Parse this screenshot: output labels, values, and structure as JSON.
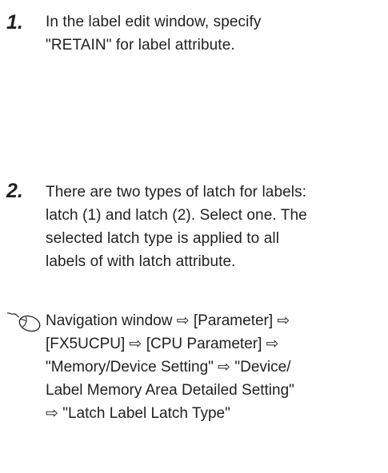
{
  "steps": [
    {
      "number": "1.",
      "lines": [
        "In the label edit window, specify",
        "\"RETAIN\" for label attribute."
      ]
    },
    {
      "number": "2.",
      "lines": [
        "There are two types of latch for labels:",
        "latch (1) and latch (2). Select one. The",
        "selected latch type is applied to all",
        "labels of with latch attribute."
      ]
    }
  ],
  "navigation": {
    "icon": "mouse-icon",
    "lines": [
      "Navigation window ⇨ [Parameter] ⇨",
      "[FX5UCPU] ⇨ [CPU Parameter] ⇨",
      "\"Memory/Device Setting\" ⇨ \"Device/",
      "Label Memory Area Detailed Setting\"",
      "⇨ \"Latch Label Latch Type\""
    ]
  }
}
